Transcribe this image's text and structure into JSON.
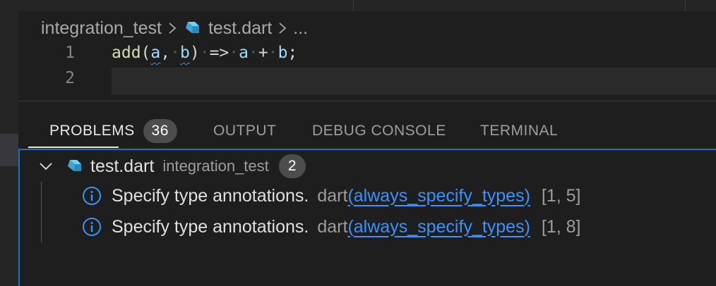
{
  "breadcrumb": {
    "folder": "integration_test",
    "file": "test.dart",
    "more": "..."
  },
  "editor": {
    "lines": [
      {
        "number": "1"
      },
      {
        "number": "2"
      }
    ],
    "code": {
      "fn": "add",
      "open": "(",
      "a": "a",
      "comma": ",",
      "b": "b",
      "close": ")",
      "arrow": "=>",
      "plus": "+",
      "semi": ";"
    }
  },
  "panel": {
    "tabs": [
      {
        "label": "PROBLEMS",
        "badge": "36"
      },
      {
        "label": "OUTPUT"
      },
      {
        "label": "DEBUG CONSOLE"
      },
      {
        "label": "TERMINAL"
      }
    ],
    "file": {
      "name": "test.dart",
      "path": "integration_test",
      "count": "2"
    },
    "problems": [
      {
        "message": "Specify type annotations.",
        "source": "dart",
        "open": "(",
        "code": "always_specify_types",
        "close": ")",
        "position": "[1, 5]"
      },
      {
        "message": "Specify type annotations.",
        "source": "dart",
        "open": "(",
        "code": "always_specify_types",
        "close": ")",
        "position": "[1, 8]"
      }
    ]
  },
  "colors": {
    "accent": "#1177bb",
    "info": "#3794ff",
    "dart": "#40c4ff"
  },
  "icons": {
    "file": "dart-file-icon",
    "expand": "chevron-down-icon",
    "problem": "info-icon"
  }
}
